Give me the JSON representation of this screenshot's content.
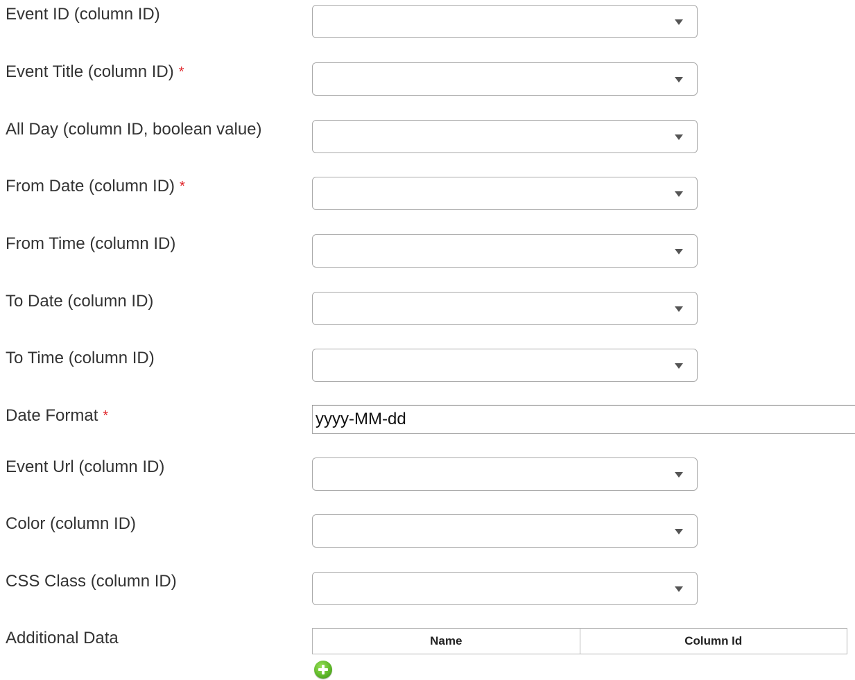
{
  "form": {
    "fields": [
      {
        "label": "Event ID (column ID)",
        "required": false,
        "value": ""
      },
      {
        "label": "Event Title (column ID)",
        "required": true,
        "value": ""
      },
      {
        "label": "All Day (column ID, boolean value)",
        "required": false,
        "value": ""
      },
      {
        "label": "From Date (column ID)",
        "required": true,
        "value": ""
      },
      {
        "label": "From Time (column ID)",
        "required": false,
        "value": ""
      },
      {
        "label": "To Date (column ID)",
        "required": false,
        "value": ""
      },
      {
        "label": "To Time (column ID)",
        "required": false,
        "value": ""
      },
      {
        "label": "Date Format",
        "required": true,
        "value": "yyyy-MM-dd"
      },
      {
        "label": "Event Url (column ID)",
        "required": false,
        "value": ""
      },
      {
        "label": "Color (column ID)",
        "required": false,
        "value": ""
      },
      {
        "label": "CSS Class (column ID)",
        "required": false,
        "value": ""
      },
      {
        "label": "Additional Data",
        "required": false
      }
    ],
    "required_marker": "*"
  },
  "additional_data": {
    "columns": [
      "Name",
      "Column Id"
    ]
  },
  "colors": {
    "required": "#e0262b",
    "add_button": "#5fb82a"
  },
  "icons": {
    "add": "plus-circle-icon",
    "dropdown": "chevron-down-icon"
  }
}
